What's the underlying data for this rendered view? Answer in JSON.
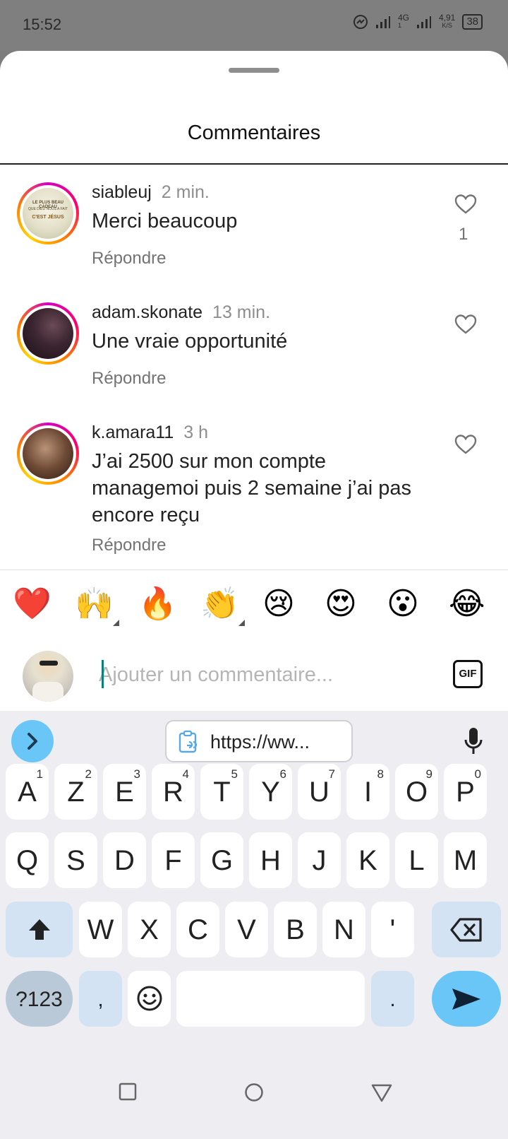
{
  "status_bar": {
    "time": "15:52",
    "network_type": "4G",
    "network_sub": "1",
    "speed_value": "4,91",
    "speed_unit": "K/S",
    "battery": "38"
  },
  "sheet": {
    "title": "Commentaires"
  },
  "comments": [
    {
      "username": "siableuj",
      "time": "2 min.",
      "text": "Merci beaucoup",
      "reply_label": "Répondre",
      "likes": "1",
      "avatar_text": [
        "LE PLUS BEAU CADEAU",
        "QUE DIEU NOUS A FAIT",
        "C'EST JÉSUS"
      ]
    },
    {
      "username": "adam.skonate",
      "time": "13 min.",
      "text": "Une vraie opportunité",
      "reply_label": "Répondre",
      "likes": ""
    },
    {
      "username": "k.amara11",
      "time": "3 h",
      "text": "J’ai 2500 sur mon compte managemoi puis 2 semaine j’ai pas encore reçu",
      "reply_label": "Répondre",
      "likes": ""
    }
  ],
  "emoji_bar": [
    "❤️",
    "🙌",
    "🔥",
    "👏",
    "😢",
    "😍",
    "😮",
    "😂"
  ],
  "composer": {
    "placeholder": "Ajouter un commentaire...",
    "gif_label": "GIF"
  },
  "keyboard": {
    "clipboard_text": "https://ww...",
    "row1": [
      [
        "A",
        "1"
      ],
      [
        "Z",
        "2"
      ],
      [
        "E",
        "3"
      ],
      [
        "R",
        "4"
      ],
      [
        "T",
        "5"
      ],
      [
        "Y",
        "6"
      ],
      [
        "U",
        "7"
      ],
      [
        "I",
        "8"
      ],
      [
        "O",
        "9"
      ],
      [
        "P",
        "0"
      ]
    ],
    "row2": [
      "Q",
      "S",
      "D",
      "F",
      "G",
      "H",
      "J",
      "K",
      "L",
      "M"
    ],
    "row3": [
      "W",
      "X",
      "C",
      "V",
      "B",
      "N",
      "'"
    ],
    "symbols_label": "?123",
    "comma_label": ",",
    "period_label": "."
  },
  "colors": {
    "accent_blue": "#6bc6f8",
    "story_ring": "#d300c5",
    "heart_red": "#e0192b"
  },
  "icons": [
    "heart-outline-icon",
    "clipboard-link-icon",
    "microphone-icon",
    "shift-icon",
    "backspace-icon",
    "send-icon",
    "smiley-icon",
    "chevron-right-icon",
    "nav-back-icon",
    "nav-home-icon",
    "nav-recents-icon"
  ]
}
